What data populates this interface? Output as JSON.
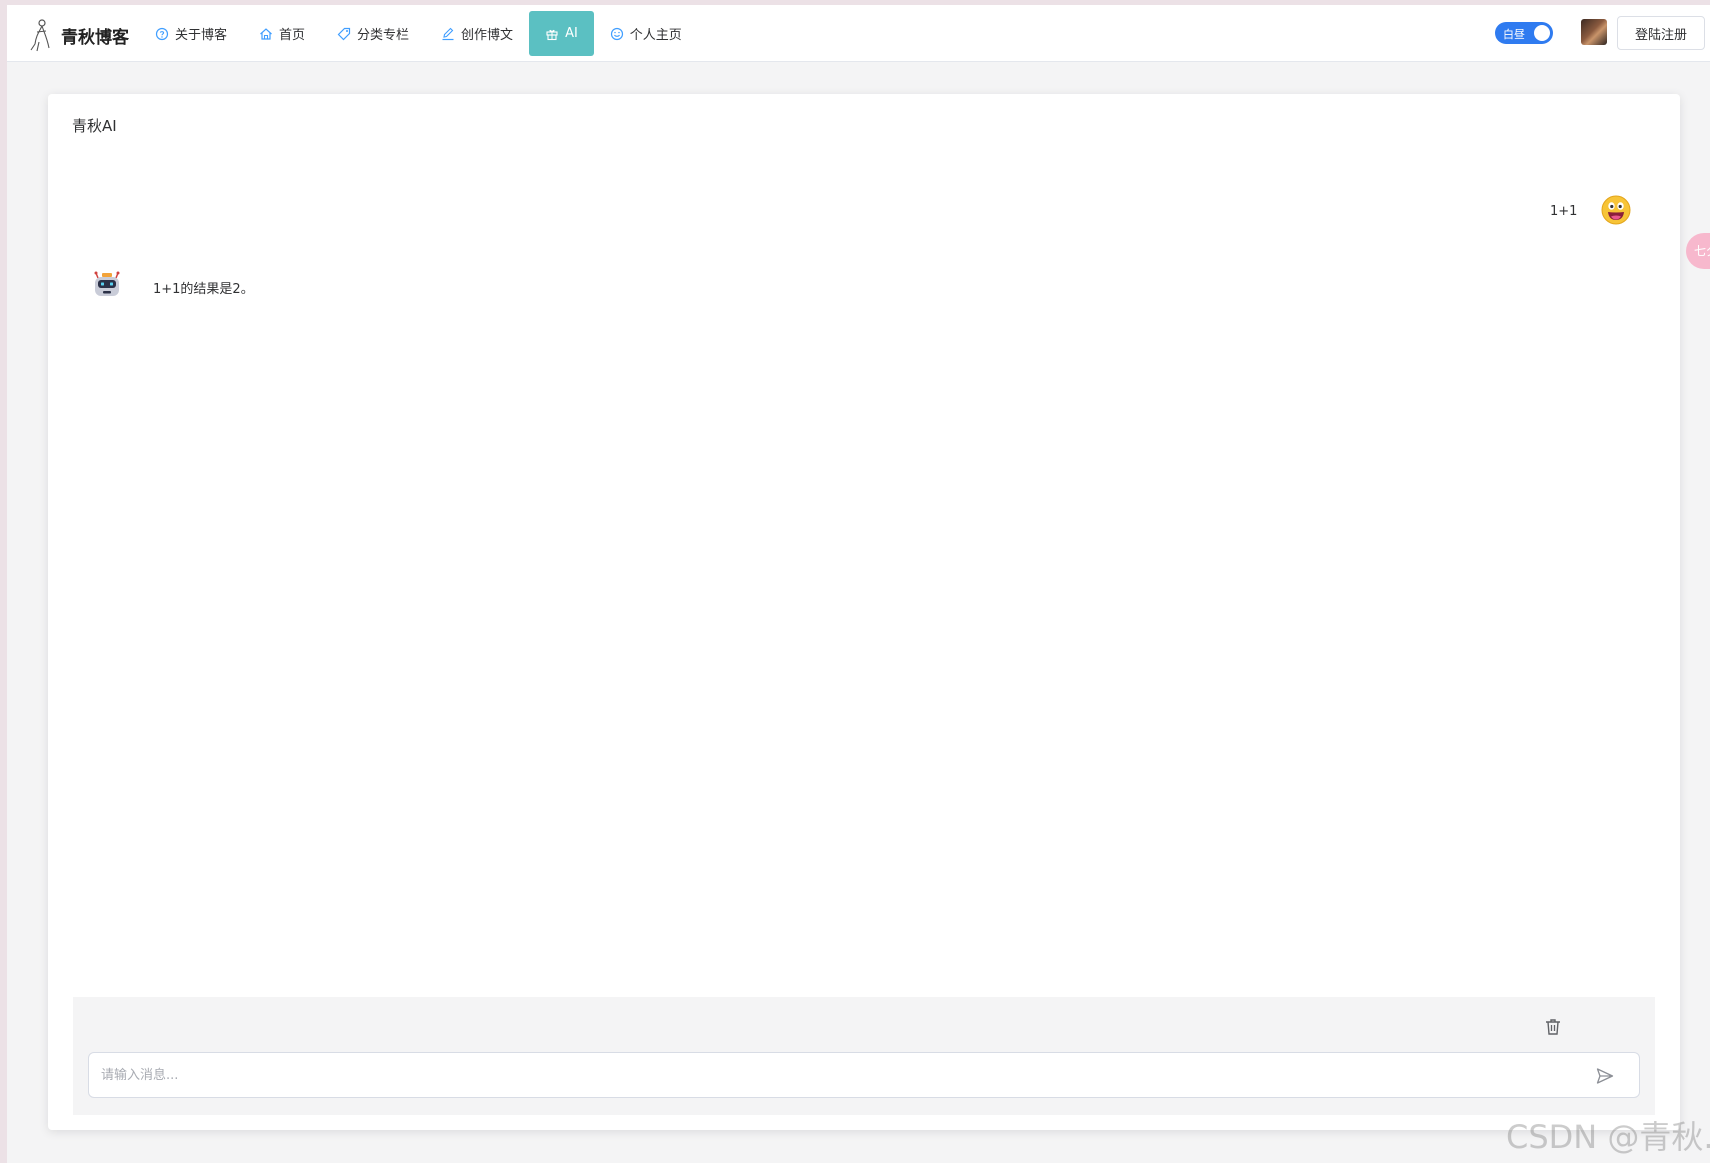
{
  "header": {
    "brand": "青秋博客",
    "nav": [
      {
        "label": "关于博客",
        "icon": "question-circle-icon"
      },
      {
        "label": "首页",
        "icon": "home-icon"
      },
      {
        "label": "分类专栏",
        "icon": "tag-icon"
      },
      {
        "label": "创作博文",
        "icon": "edit-icon"
      },
      {
        "label": "AI",
        "icon": "gift-icon",
        "active": true
      },
      {
        "label": "个人主页",
        "icon": "smile-circle-icon"
      }
    ],
    "theme_toggle": {
      "label": "白昼",
      "on": true
    },
    "login_label": "登陆注册"
  },
  "chat": {
    "title": "青秋AI",
    "messages": [
      {
        "role": "user",
        "text": "1+1"
      },
      {
        "role": "assistant",
        "text": "1+1的结果是2。"
      }
    ],
    "input": {
      "placeholder": "请输入消息...",
      "value": ""
    }
  },
  "side_tab_label": "七夕",
  "watermark": "CSDN @青秋.",
  "colors": {
    "accent": "#5bc0c2",
    "switch": "#2f7bf0",
    "nav_icon": "#409eff",
    "page_bg": "#f4f4f5"
  }
}
